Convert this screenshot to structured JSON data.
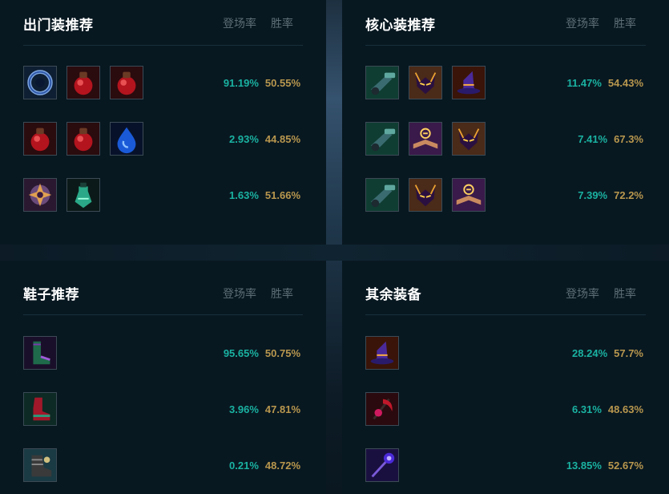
{
  "panels": [
    {
      "title": "出门装推荐",
      "col_pick": "登场率",
      "col_win": "胜率",
      "rows": [
        {
          "icons": [
            "dark-seal-icon",
            "health-potion-icon",
            "health-potion-icon"
          ],
          "pick": "91.19%",
          "win": "50.55%"
        },
        {
          "icons": [
            "health-potion-icon",
            "health-potion-icon",
            "mana-tear-icon"
          ],
          "pick": "2.93%",
          "win": "44.85%"
        },
        {
          "icons": [
            "shield-crest-icon",
            "refillable-potion-icon"
          ],
          "pick": "1.63%",
          "win": "51.66%"
        }
      ]
    },
    {
      "title": "核心装推荐",
      "col_pick": "登场率",
      "col_win": "胜率",
      "rows": [
        {
          "icons": [
            "cannon-gun-icon",
            "horned-mask-icon",
            "witch-hat-icon"
          ],
          "pick": "11.47%",
          "win": "54.43%"
        },
        {
          "icons": [
            "cannon-gun-icon",
            "spell-book-icon",
            "horned-mask-icon"
          ],
          "pick": "7.41%",
          "win": "67.3%"
        },
        {
          "icons": [
            "cannon-gun-icon",
            "horned-mask-icon",
            "spell-book-icon"
          ],
          "pick": "7.39%",
          "win": "72.2%"
        }
      ]
    },
    {
      "title": "鞋子推荐",
      "col_pick": "登场率",
      "col_win": "胜率",
      "rows": [
        {
          "icons": [
            "sorcerer-shoes-icon"
          ],
          "pick": "95.65%",
          "win": "50.75%"
        },
        {
          "icons": [
            "mercury-boots-icon"
          ],
          "pick": "3.96%",
          "win": "47.81%"
        },
        {
          "icons": [
            "steel-boots-icon"
          ],
          "pick": "0.21%",
          "win": "48.72%"
        }
      ]
    },
    {
      "title": "其余装备",
      "col_pick": "登场率",
      "col_win": "胜率",
      "rows": [
        {
          "icons": [
            "witch-hat-icon"
          ],
          "pick": "28.24%",
          "win": "57.7%"
        },
        {
          "icons": [
            "dark-scythe-icon"
          ],
          "pick": "6.31%",
          "win": "48.63%"
        },
        {
          "icons": [
            "void-staff-icon"
          ],
          "pick": "13.85%",
          "win": "52.67%"
        }
      ]
    }
  ]
}
